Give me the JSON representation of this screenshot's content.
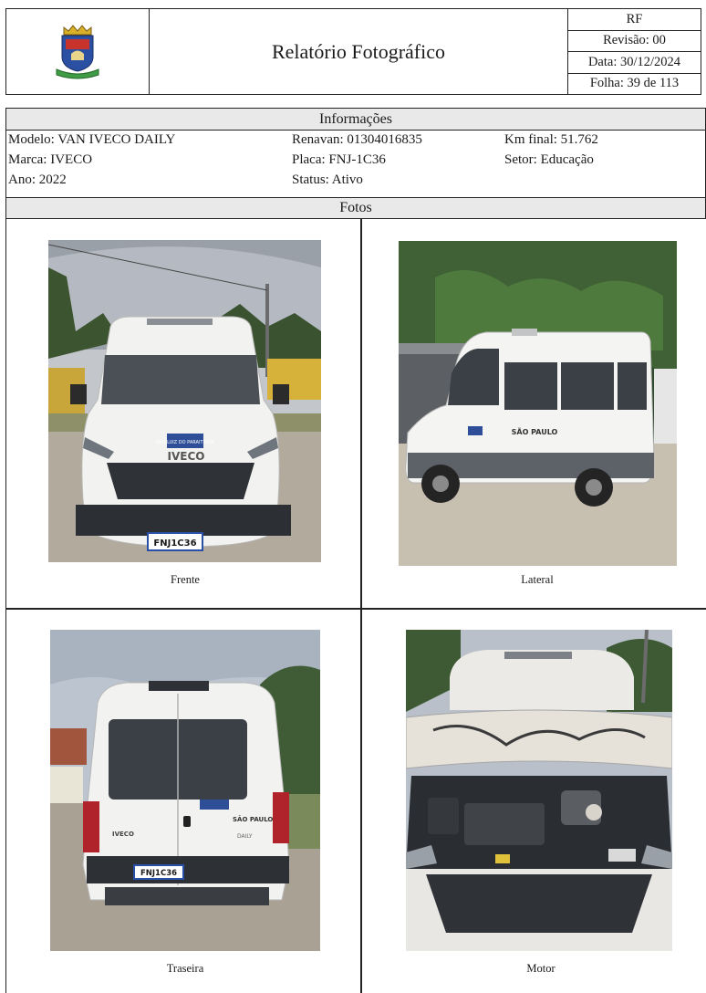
{
  "header": {
    "title": "Relatório Fotográfico",
    "code": "RF",
    "revision": "Revisão: 00",
    "date": "Data: 30/12/2024",
    "sheet": "Folha: 39 de 113"
  },
  "info": {
    "section_title": "Informações",
    "modelo": "Modelo: VAN IVECO DAILY",
    "marca": "Marca: IVECO",
    "ano": "Ano: 2022",
    "renavan": "Renavan: 01304016835",
    "placa": "Placa: FNJ-1C36",
    "status": "Status: Ativo",
    "km_final": "Km final: 51.762",
    "setor": "Setor: Educação"
  },
  "photos": {
    "section_title": "Fotos",
    "items": [
      {
        "caption": "Frente",
        "plate_text": "FNJ1C36",
        "badge": "SÃO LUIZ DO PARAITINGA",
        "brand": "IVECO"
      },
      {
        "caption": "Lateral",
        "side_text": "SÃO PAULO"
      },
      {
        "caption": "Traseira",
        "plate_text": "FNJ1C36",
        "brand": "IVECO",
        "model_text": "DAILY",
        "side_text": "SÃO PAULO"
      },
      {
        "caption": "Motor"
      }
    ]
  },
  "colors": {
    "section_bar": "#e9e9e9",
    "border": "#222222",
    "van_white": "#f2f2f0",
    "sky": "#c9ccd0",
    "foliage": "#3e5a34",
    "gravel": "#b2aa9c"
  }
}
